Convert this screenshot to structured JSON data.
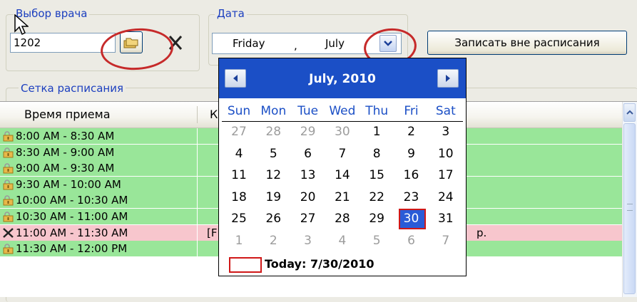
{
  "doctor_group": {
    "label": "Выбор врача",
    "value": "1202",
    "lookup_icon": "folders-icon",
    "clear_icon": "close-icon"
  },
  "date_group": {
    "label": "Дата",
    "weekday": "Friday",
    "separator": ",",
    "month": "July",
    "dropdown_icon": "chevron-down-icon"
  },
  "book_button": {
    "label": "Записать вне расписания"
  },
  "schedule_group": {
    "label": "Сетка расписания",
    "columns": [
      "Время приема",
      "К"
    ],
    "rows": [
      {
        "time": "8:00 AM - 8:30 AM",
        "status": "free",
        "text": ""
      },
      {
        "time": "8:30 AM - 9:00 AM",
        "status": "free",
        "text": ""
      },
      {
        "time": "9:00 AM - 9:30 AM",
        "status": "free",
        "text": ""
      },
      {
        "time": "9:30 AM - 10:00 AM",
        "status": "free",
        "text": ""
      },
      {
        "time": "10:00 AM - 10:30 AM",
        "status": "free",
        "text": ""
      },
      {
        "time": "10:30 AM - 11:00 AM",
        "status": "free",
        "text": ""
      },
      {
        "time": "11:00 AM - 11:30 AM",
        "status": "busy",
        "text": "[F",
        "tail": "р."
      },
      {
        "time": "11:30 AM - 12:00 PM",
        "status": "free",
        "text": ""
      }
    ],
    "colors": {
      "free": "#99e699",
      "busy": "#f7c6cd"
    }
  },
  "calendar": {
    "title": "July, 2010",
    "prev_label": "<",
    "next_label": ">",
    "days_of_week": [
      "Sun",
      "Mon",
      "Tue",
      "Wed",
      "Thu",
      "Fri",
      "Sat"
    ],
    "weeks": [
      [
        "27",
        "28",
        "29",
        "30",
        "1",
        "2",
        "3"
      ],
      [
        "4",
        "5",
        "6",
        "7",
        "8",
        "9",
        "10"
      ],
      [
        "11",
        "12",
        "13",
        "14",
        "15",
        "16",
        "17"
      ],
      [
        "18",
        "19",
        "20",
        "21",
        "22",
        "23",
        "24"
      ],
      [
        "25",
        "26",
        "27",
        "28",
        "29",
        "30",
        "31"
      ],
      [
        "1",
        "2",
        "3",
        "4",
        "5",
        "6",
        "7"
      ]
    ],
    "other_month": [
      [
        0,
        0
      ],
      [
        0,
        1
      ],
      [
        0,
        2
      ],
      [
        0,
        3
      ],
      [
        5,
        0
      ],
      [
        5,
        1
      ],
      [
        5,
        2
      ],
      [
        5,
        3
      ],
      [
        5,
        4
      ],
      [
        5,
        5
      ],
      [
        5,
        6
      ]
    ],
    "selected": [
      4,
      5
    ],
    "today_label": "Today: 7/30/2010",
    "header_color": "#1b4fc6"
  }
}
